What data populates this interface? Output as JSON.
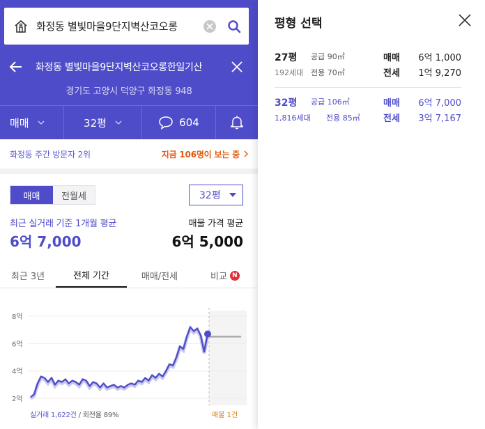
{
  "search": {
    "query": "화정동 별빛마을9단지벽산코오롱"
  },
  "header": {
    "apartment_name": "화정동 별빛마을9단지벽산코오롱한일기산",
    "address": "경기도 고양시 덕양구 화정동 948"
  },
  "selectors": {
    "deal_type": "매매",
    "size": "32평",
    "comment_count": "604"
  },
  "visitors": {
    "rank_text": "화정동 주간 방문자 2위",
    "now_text": "지금 106명이 보는 중"
  },
  "deal_tabs": [
    "매매",
    "전월세"
  ],
  "size_dropdown": "32평",
  "summary": {
    "recent_label": "최근 실거래 기준 1개월 평균",
    "recent_price": "6억 7,000",
    "listing_label": "매물 가격 평균",
    "listing_price": "6억 5,000"
  },
  "period_tabs": {
    "recent3y": "최근 3년",
    "all": "전체 기간",
    "type": "매매/전세",
    "compare": "비교",
    "badge": "N"
  },
  "chart_footer": {
    "transactions": "실거래 1,622건",
    "turnover": "/ 회전율 89%",
    "listings": "매물 1건"
  },
  "chart_data": {
    "type": "line",
    "yticks": [
      "8억",
      "6억",
      "4억",
      "2억"
    ],
    "y_values": [
      8,
      6,
      4,
      2
    ],
    "ylim": [
      1.5,
      8.5
    ],
    "unit": "억",
    "series": [
      {
        "values": [
          2.1,
          2.3,
          3.1,
          3.6,
          3.5,
          3.2,
          3.5,
          3.0,
          3.3,
          3.2,
          3.4,
          3.1,
          3.3,
          3.2,
          3.0,
          3.4,
          3.3,
          2.9,
          3.2,
          3.1,
          2.8,
          3.1,
          2.8,
          2.9,
          3.0,
          2.8,
          2.9,
          2.8,
          3.0,
          3.1,
          3.0,
          3.3,
          3.2,
          3.5,
          3.3,
          3.7,
          3.5,
          3.8,
          3.6,
          4.0,
          4.5,
          4.4,
          5.0,
          5.8,
          5.6,
          6.5,
          7.2,
          6.9,
          7.1,
          6.6,
          5.4,
          6.7
        ]
      }
    ],
    "listing_value": 6.5
  },
  "size_panel": {
    "title": "평형 선택",
    "rows": [
      {
        "pyeong": "27평",
        "units": "192세대",
        "supply": "공급 90㎡",
        "exclusive": "전용 70㎡",
        "deal1": "매매",
        "price1": "6억 1,000",
        "deal2": "전세",
        "price2": "1억 9,270"
      },
      {
        "pyeong": "32평",
        "units": "1,816세대",
        "supply": "공급 106㎡",
        "exclusive": "전용 85㎡",
        "deal1": "매매",
        "price1": "6억 7,000",
        "deal2": "전세",
        "price2": "3억 7,167"
      }
    ]
  },
  "colors": {
    "brand": "#4f4cc9",
    "highlight": "#e05a10",
    "listing": "#e07a10",
    "badge": "#e0303a"
  }
}
